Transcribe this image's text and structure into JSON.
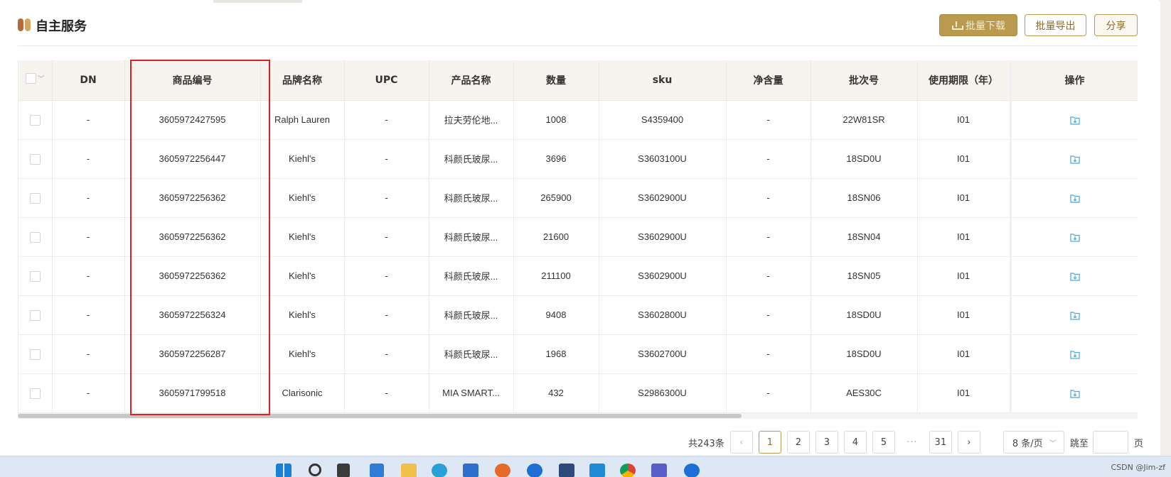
{
  "header": {
    "title": "自主服务",
    "btn_download": "批量下载",
    "btn_export": "批量导出",
    "btn_share": "分享"
  },
  "table": {
    "columns": [
      "DN",
      "商品编号",
      "品牌名称",
      "UPC",
      "产品名称",
      "数量",
      "sku",
      "净含量",
      "批次号",
      "使用期限（年）",
      "操作"
    ],
    "rows": [
      {
        "dn": "-",
        "code": "3605972427595",
        "brand": "Ralph Lauren",
        "upc": "-",
        "name": "拉夫劳伦地...",
        "qty": "1008",
        "sku": "S4359400",
        "net": "-",
        "batch": "22W81SR",
        "term": "I01"
      },
      {
        "dn": "-",
        "code": "3605972256447",
        "brand": "Kiehl's",
        "upc": "-",
        "name": "科颜氏玻尿...",
        "qty": "3696",
        "sku": "S3603100U",
        "net": "-",
        "batch": "18SD0U",
        "term": "I01"
      },
      {
        "dn": "-",
        "code": "3605972256362",
        "brand": "Kiehl's",
        "upc": "-",
        "name": "科颜氏玻尿...",
        "qty": "265900",
        "sku": "S3602900U",
        "net": "-",
        "batch": "18SN06",
        "term": "I01"
      },
      {
        "dn": "-",
        "code": "3605972256362",
        "brand": "Kiehl's",
        "upc": "-",
        "name": "科颜氏玻尿...",
        "qty": "21600",
        "sku": "S3602900U",
        "net": "-",
        "batch": "18SN04",
        "term": "I01"
      },
      {
        "dn": "-",
        "code": "3605972256362",
        "brand": "Kiehl's",
        "upc": "-",
        "name": "科颜氏玻尿...",
        "qty": "211100",
        "sku": "S3602900U",
        "net": "-",
        "batch": "18SN05",
        "term": "I01"
      },
      {
        "dn": "-",
        "code": "3605972256324",
        "brand": "Kiehl's",
        "upc": "-",
        "name": "科颜氏玻尿...",
        "qty": "9408",
        "sku": "S3602800U",
        "net": "-",
        "batch": "18SD0U",
        "term": "I01"
      },
      {
        "dn": "-",
        "code": "3605972256287",
        "brand": "Kiehl's",
        "upc": "-",
        "name": "科颜氏玻尿...",
        "qty": "1968",
        "sku": "S3602700U",
        "net": "-",
        "batch": "18SD0U",
        "term": "I01"
      },
      {
        "dn": "-",
        "code": "3605971799518",
        "brand": "Clarisonic",
        "upc": "-",
        "name": "MIA SMART...",
        "qty": "432",
        "sku": "S2986300U",
        "net": "-",
        "batch": "AES30C",
        "term": "I01"
      }
    ]
  },
  "pagination": {
    "total": "共243条",
    "prev": "‹",
    "next": "›",
    "pages": [
      "1",
      "2",
      "3",
      "4",
      "5"
    ],
    "ellipsis": "···",
    "last": "31",
    "page_size": "8 条/页",
    "jump_label": "跳至",
    "page_suffix": "页"
  },
  "watermark": "CSDN @Jim-zf",
  "colors": {
    "accent": "#b99a4f",
    "highlight_box": "#e0201f",
    "header_bg": "#f7f3ee"
  }
}
